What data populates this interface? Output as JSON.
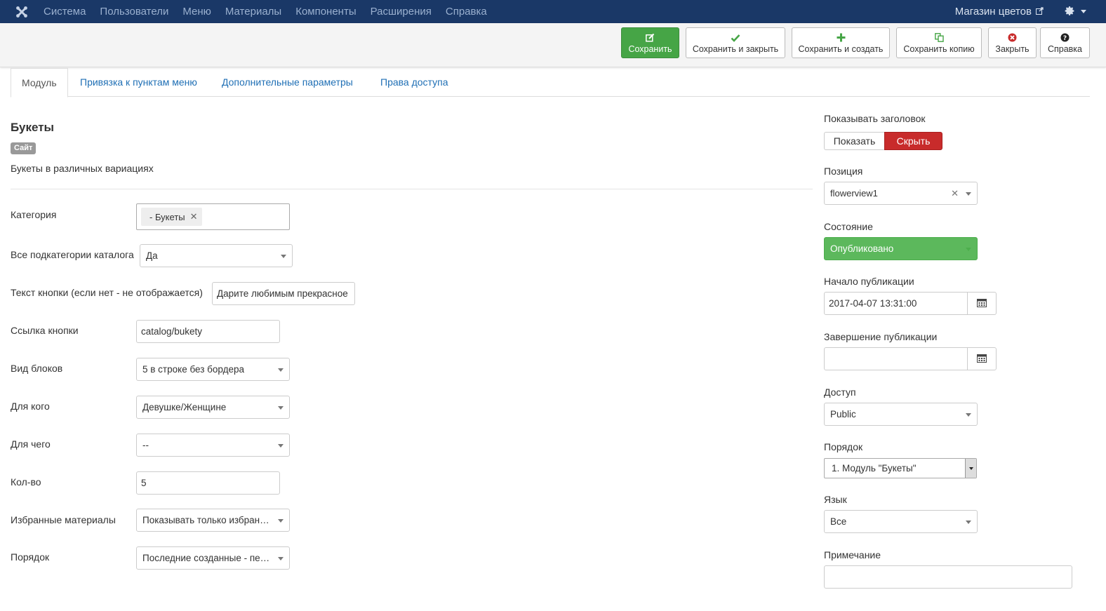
{
  "navbar": {
    "menu": [
      "Система",
      "Пользователи",
      "Меню",
      "Материалы",
      "Компоненты",
      "Расширения",
      "Справка"
    ],
    "site_name": "Магазин цветов"
  },
  "toolbar": {
    "save": "Сохранить",
    "save_close": "Сохранить и закрыть",
    "save_new": "Сохранить и создать",
    "save_copy": "Сохранить копию",
    "close": "Закрыть",
    "help": "Справка"
  },
  "tabs": [
    "Модуль",
    "Привязка к пунктам меню",
    "Дополнительные параметры",
    "Права доступа"
  ],
  "module": {
    "title": "Букеты",
    "badge": "Сайт",
    "description": "Букеты в различных вариациях"
  },
  "form": {
    "category": {
      "label": "Категория",
      "chip": "- Букеты"
    },
    "subcats": {
      "label": "Все подкатегории каталога",
      "value": "Да"
    },
    "btn_text": {
      "label": "Текст кнопки (если нет - не отображается)",
      "value": "Дарите любимым прекрасное"
    },
    "btn_link": {
      "label": "Ссылка кнопки",
      "value": "catalog/bukety"
    },
    "blocks_view": {
      "label": "Вид блоков",
      "value": "5 в строке без бордера"
    },
    "for_whom": {
      "label": "Для кого",
      "value": "Девушке/Женщине"
    },
    "for_what": {
      "label": "Для чего",
      "value": "--"
    },
    "count": {
      "label": "Кол-во",
      "value": "5"
    },
    "featured": {
      "label": "Избранные материалы",
      "value": "Показывать только избранные"
    },
    "ordering": {
      "label": "Порядок",
      "value": "Последние созданные - первыми"
    }
  },
  "side": {
    "show_title": {
      "label": "Показывать заголовок",
      "show": "Показать",
      "hide": "Скрыть"
    },
    "position": {
      "label": "Позиция",
      "value": "flowerview1"
    },
    "status": {
      "label": "Состояние",
      "value": "Опубликовано"
    },
    "publish_up": {
      "label": "Начало публикации",
      "value": "2017-04-07 13:31:00"
    },
    "publish_down": {
      "label": "Завершение публикации",
      "value": ""
    },
    "access": {
      "label": "Доступ",
      "value": "Public"
    },
    "order": {
      "label": "Порядок",
      "value": "1. Модуль \"Букеты\""
    },
    "language": {
      "label": "Язык",
      "value": "Все"
    },
    "note": {
      "label": "Примечание",
      "value": ""
    }
  },
  "colors": {
    "navbar": "#1a3867",
    "success": "#46a546",
    "danger": "#c82b2b",
    "link": "#1f6fb5"
  }
}
